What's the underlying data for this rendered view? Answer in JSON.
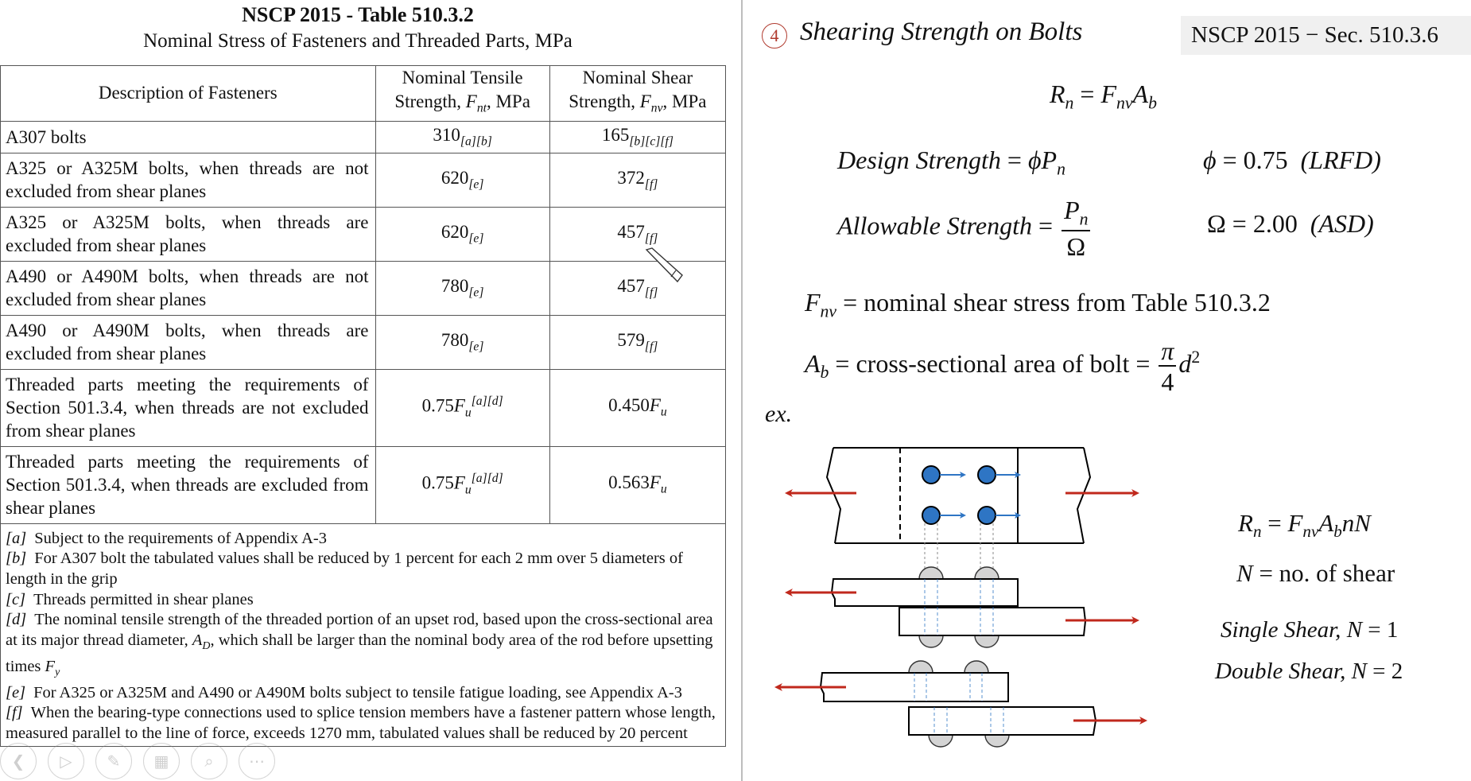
{
  "left_panel": {
    "title": "NSCP 2015 - Table 510.3.2",
    "subtitle": "Nominal Stress of Fasteners and Threaded Parts, MPa",
    "table": {
      "headers": {
        "description": "Description of Fasteners",
        "tensile_line1": "Nominal Tensile",
        "tensile_line2_prefix": "Strength, ",
        "tensile_symbol": "F",
        "tensile_sub": "nt",
        "tensile_suffix": ", MPa",
        "shear_line1": "Nominal Shear",
        "shear_line2_prefix": "Strength, ",
        "shear_symbol": "F",
        "shear_sub": "nv",
        "shear_suffix": ", MPa"
      },
      "rows": [
        {
          "description": "A307 bolts",
          "tensile": "310",
          "tensile_notes": "[a][b]",
          "tensile_notes_pos": "sub",
          "shear": "165",
          "shear_notes": "[b][c][f]",
          "shear_notes_pos": "sub"
        },
        {
          "description": "A325 or A325M bolts, when threads are not excluded from shear planes",
          "tensile": "620",
          "tensile_notes": "[e]",
          "shear": "372",
          "shear_notes": "[f]"
        },
        {
          "description": "A325 or A325M bolts, when threads are excluded from shear planes",
          "tensile": "620",
          "tensile_notes": "[e]",
          "shear": "457",
          "shear_notes": "[f]"
        },
        {
          "description": "A490 or A490M bolts, when threads are not excluded from shear planes",
          "tensile": "780",
          "tensile_notes": "[e]",
          "shear": "457",
          "shear_notes": "[f]"
        },
        {
          "description": "A490 or A490M bolts, when threads are excluded from shear planes",
          "tensile": "780",
          "tensile_notes": "[e]",
          "shear": "579",
          "shear_notes": "[f]"
        },
        {
          "description": "Threaded parts meeting the requirements of Section 501.3.4, when threads are not excluded from shear planes",
          "tensile_coef": "0.75",
          "tensile_symbol": "F",
          "tensile_sub": "u",
          "tensile_notes": "[a][d]",
          "shear_coef": "0.450",
          "shear_symbol": "F",
          "shear_sub": "u"
        },
        {
          "description": "Threaded parts meeting the requirements of Section 501.3.4, when threads are excluded from shear planes",
          "tensile_coef": "0.75",
          "tensile_symbol": "F",
          "tensile_sub": "u",
          "tensile_notes": "[a][d]",
          "shear_coef": "0.563",
          "shear_symbol": "F",
          "shear_sub": "u"
        }
      ],
      "footnotes": [
        {
          "tag": "[a]",
          "text": "Subject to the requirements of Appendix A-3"
        },
        {
          "tag": "[b]",
          "text": "For A307 bolt the tabulated values shall be reduced by 1 percent for each 2 mm over 5 diameters of length in the grip"
        },
        {
          "tag": "[c]",
          "text": "Threads permitted in shear planes"
        },
        {
          "tag": "[d]",
          "text_before": "The nominal tensile strength of the threaded portion of an upset rod, based upon the cross-sectional area at its major thread diameter, ",
          "sym1": "A",
          "sym1_sub": "D",
          "text_mid": ", which shall be larger than the nominal body area of the rod before upsetting times ",
          "sym2": "F",
          "sym2_sub": "y"
        },
        {
          "tag": "[e]",
          "text": "For A325 or A325M and A490 or A490M bolts subject to tensile fatigue loading, see Appendix A-3"
        },
        {
          "tag": "[f]",
          "text": "When the bearing-type connections used to splice tension members have a fastener pattern whose length, measured parallel to the line of force, exceeds 1270 mm, tabulated values shall be reduced by 20 percent"
        }
      ]
    }
  },
  "right_panel": {
    "section_number": "4",
    "section_title": "Shearing Strength on Bolts",
    "code_reference": "NSCP 2015 − Sec. 510.3.6",
    "equations": {
      "rn": {
        "lhs": "R",
        "lhs_sub": "n",
        "eq": " = ",
        "r1": "F",
        "r1_sub": "nv",
        "r2": "A",
        "r2_sub": "b"
      },
      "design": {
        "label": "Design Strength",
        "eq": " = ",
        "phi": "ϕ",
        "p": "P",
        "p_sub": "n"
      },
      "phi_value": {
        "sym": "ϕ",
        "eq": " = ",
        "value": "0.75",
        "method": "(LRFD)"
      },
      "allowable": {
        "label": "Allowable Strength",
        "eq": " = ",
        "num": "P",
        "num_sub": "n",
        "den": "Ω"
      },
      "omega_value": {
        "sym": "Ω",
        "eq": " = ",
        "value": "2.00",
        "method": "(ASD)"
      },
      "fnv_def": {
        "sym": "F",
        "sub": "nv",
        "eq": " = ",
        "text": "nominal shear stress from Table 510.3.2"
      },
      "ab_def": {
        "sym": "A",
        "sub": "b",
        "eq": " = ",
        "text": "cross-sectional area of bolt",
        "eq2": " = ",
        "num": "π",
        "den": "4",
        "var": "d",
        "exp": "2"
      },
      "example_label": "ex.",
      "rn_total": {
        "lhs": "R",
        "lhs_sub": "n",
        "eq": " = ",
        "r1": "F",
        "r1_sub": "nv",
        "r2": "A",
        "r2_sub": "b",
        "r3": "nN"
      },
      "n_def": {
        "sym": "N",
        "eq": " = ",
        "text": "no. of shear"
      },
      "single": {
        "label": "Single Shear, ",
        "sym": "N",
        "eq": " = ",
        "value": "1"
      },
      "double": {
        "label": "Double Shear, ",
        "sym": "N",
        "eq": " = ",
        "value": "2"
      }
    },
    "diagram": {
      "description": "bolted lap and butt connections under tension",
      "bolt_rows": 2,
      "bolts_per_row": 2,
      "colors": {
        "force_arrow": "#c0281c",
        "bolt_fill": "#2e75c4",
        "bolt_arrow": "#2e75c4",
        "bolt_head": "#d4d4d4",
        "outline": "#000000"
      }
    }
  },
  "slide_toolbar": {
    "buttons": [
      {
        "name": "previous-slide",
        "icon": "❮"
      },
      {
        "name": "next-slide",
        "icon": "▷"
      },
      {
        "name": "pen-tool",
        "icon": "✎"
      },
      {
        "name": "see-all-slides",
        "icon": "▦"
      },
      {
        "name": "zoom",
        "icon": "⌕"
      },
      {
        "name": "more-options",
        "icon": "⋯"
      }
    ]
  }
}
